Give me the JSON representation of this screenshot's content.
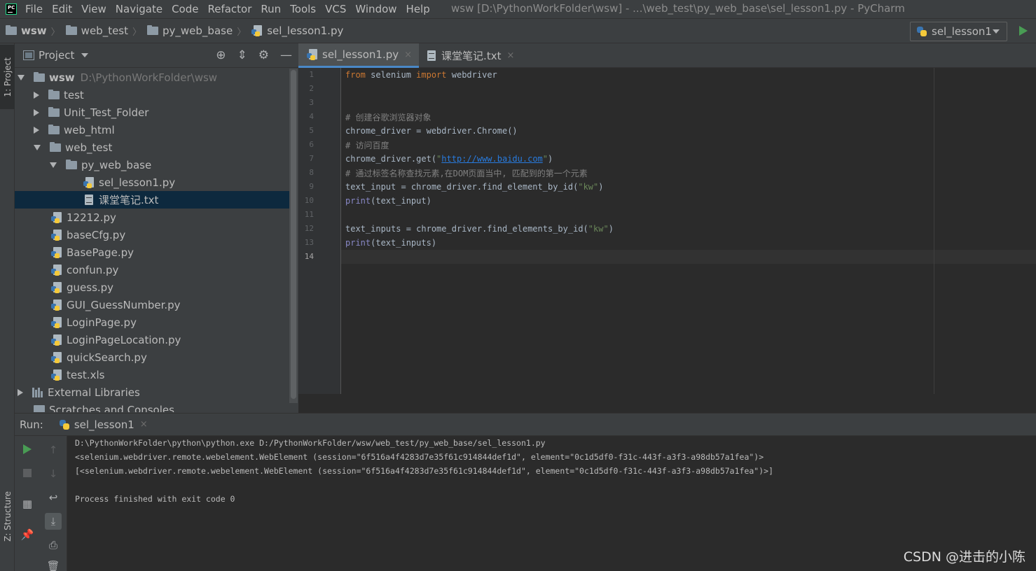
{
  "app": {
    "logo_text": "PC",
    "window_title": "wsw [D:\\PythonWorkFolder\\wsw] - ...\\web_test\\py_web_base\\sel_lesson1.py - PyCharm"
  },
  "menu": [
    "File",
    "Edit",
    "View",
    "Navigate",
    "Code",
    "Refactor",
    "Run",
    "Tools",
    "VCS",
    "Window",
    "Help"
  ],
  "breadcrumbs": [
    "wsw",
    "web_test",
    "py_web_base",
    "sel_lesson1.py"
  ],
  "run_config": {
    "label": "sel_lesson1"
  },
  "left_stripe": {
    "project": "1: Project",
    "structure": "Z: Structure"
  },
  "project_panel": {
    "title": "Project",
    "tree": {
      "root_name": "wsw",
      "root_path": "D:\\PythonWorkFolder\\wsw",
      "items": [
        "test",
        "Unit_Test_Folder",
        "web_html",
        "web_test",
        "py_web_base",
        "sel_lesson1.py",
        "课堂笔记.txt",
        "12212.py",
        "baseCfg.py",
        "BasePage.py",
        "confun.py",
        "guess.py",
        "GUI_GuessNumber.py",
        "LoginPage.py",
        "LoginPageLocation.py",
        "quickSearch.py",
        "test.xls",
        "External Libraries",
        "Scratches and Consoles"
      ]
    }
  },
  "editor": {
    "tabs": [
      {
        "label": "sel_lesson1.py",
        "close": "×"
      },
      {
        "label": "课堂笔记.txt",
        "close": "×"
      }
    ],
    "line_numbers": [
      "1",
      "2",
      "3",
      "4",
      "5",
      "6",
      "7",
      "8",
      "9",
      "10",
      "11",
      "12",
      "13",
      "14"
    ],
    "code": {
      "l1_from": "from",
      "l1_mod": " selenium ",
      "l1_import": "import",
      "l1_name": " webdriver",
      "l4": "# 创建谷歌浏览器对象",
      "l5": "chrome_driver = webdriver.Chrome()",
      "l6": "# 访问百度",
      "l7_pre": "chrome_driver.get(",
      "l7_q1": "\"",
      "l7_url": "http://www.baidu.com",
      "l7_q2": "\"",
      "l7_post": ")",
      "l8": "# 通过标签名称查找元素,在DOM页面当中, 匹配到的第一个元素",
      "l9_pre": "text_input = chrome_driver.find_element_by_id(",
      "l9_str": "\"kw\"",
      "l9_post": ")",
      "l10_fn": "print",
      "l10_rest": "(text_input)",
      "l12_pre": "text_inputs = chrome_driver.find_elements_by_id(",
      "l12_str": "\"kw\"",
      "l12_post": ")",
      "l13_fn": "print",
      "l13_rest": "(text_inputs)"
    }
  },
  "run_panel": {
    "label": "Run:",
    "tab": "sel_lesson1",
    "close": "×",
    "console": [
      "D:\\PythonWorkFolder\\python\\python.exe D:/PythonWorkFolder/wsw/web_test/py_web_base/sel_lesson1.py",
      "<selenium.webdriver.remote.webelement.WebElement (session=\"6f516a4f4283d7e35f61c914844def1d\", element=\"0c1d5df0-f31c-443f-a3f3-a98db57a1fea\")>",
      "[<selenium.webdriver.remote.webelement.WebElement (session=\"6f516a4f4283d7e35f61c914844def1d\", element=\"0c1d5df0-f31c-443f-a3f3-a98db57a1fea\")>]",
      "",
      "Process finished with exit code 0"
    ]
  },
  "watermark": "CSDN @进击的小陈"
}
